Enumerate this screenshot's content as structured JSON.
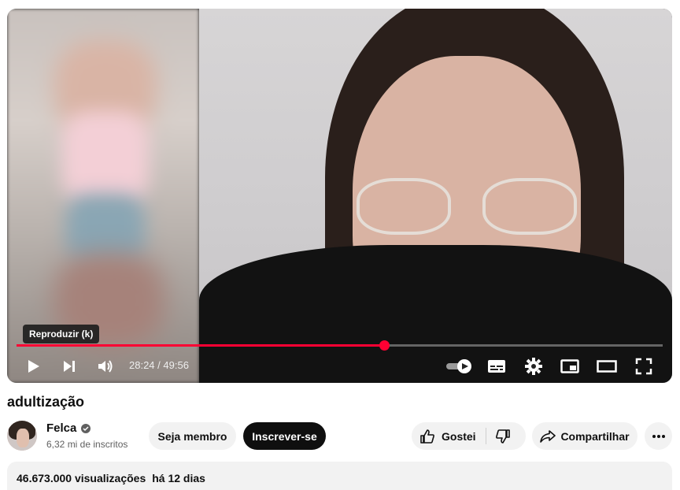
{
  "player": {
    "tooltip": "Reproduzir (k)",
    "time_current": "28:24",
    "time_separator": " / ",
    "time_total": "49:56",
    "progress_fraction": 0.569,
    "progress_color": "#ff0033",
    "icons": [
      "play-icon",
      "next-icon",
      "volume-icon",
      "autoplay-toggle-icon",
      "subtitles-icon",
      "settings-icon",
      "miniplayer-icon",
      "theater-icon",
      "fullscreen-icon"
    ]
  },
  "video": {
    "title": "adultização"
  },
  "channel": {
    "name": "Felca",
    "subscribers": "6,32 mi de inscritos",
    "member_label": "Seja membro",
    "subscribe_label": "Inscrever-se"
  },
  "actions": {
    "like_label": "Gostei",
    "share_label": "Compartilhar"
  },
  "description": {
    "views": "46.673.000 visualizações",
    "date": "há 12 dias"
  }
}
